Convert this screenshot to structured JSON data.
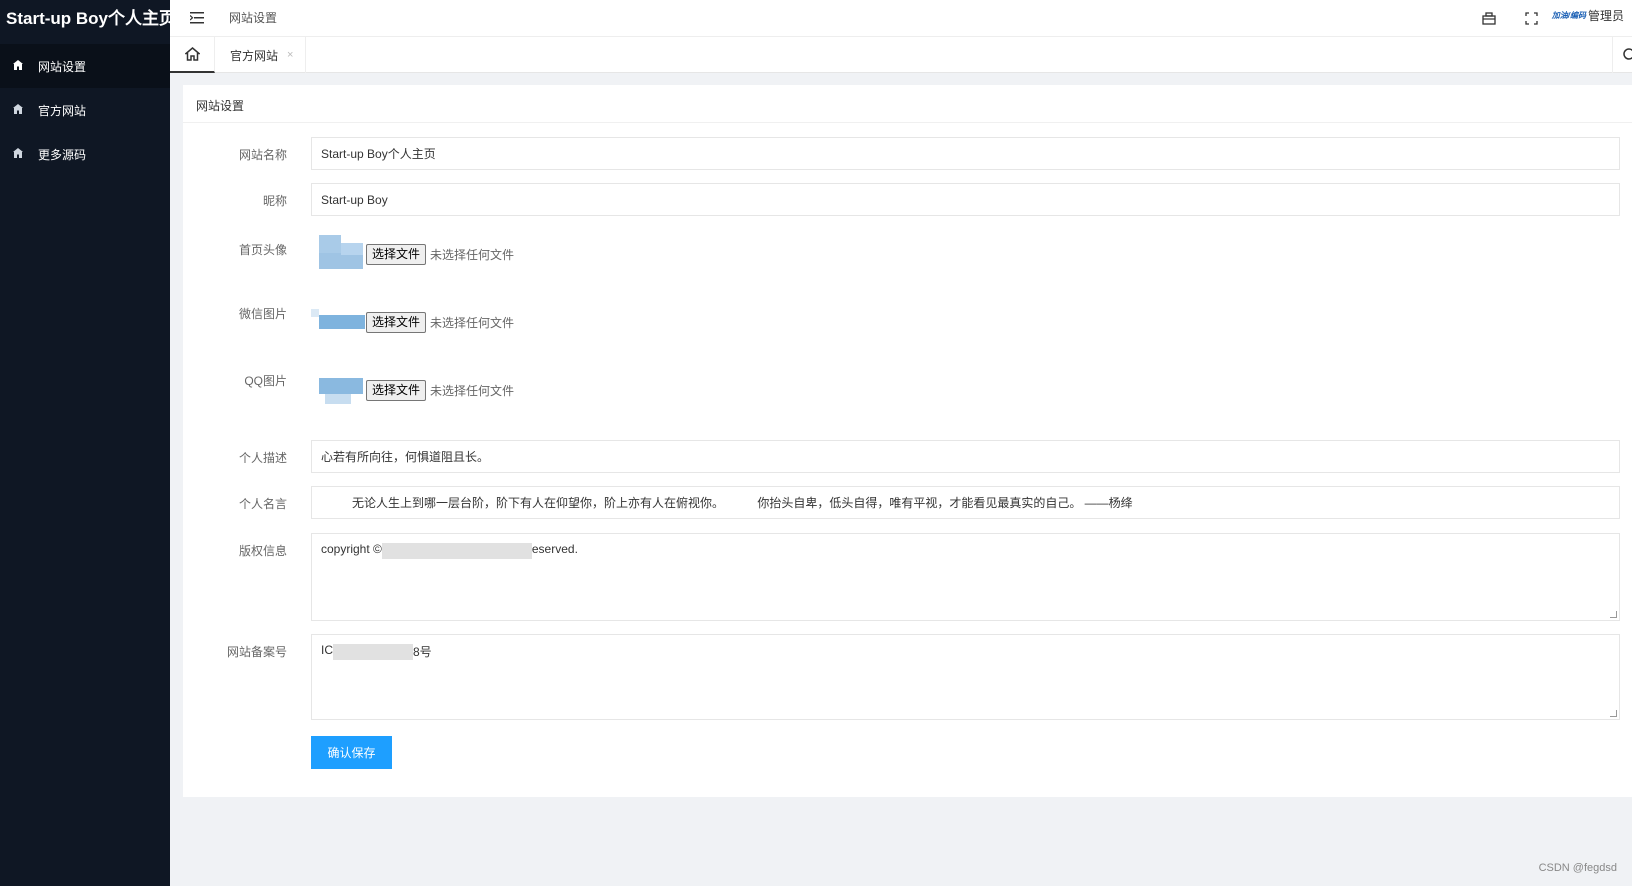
{
  "sidebar": {
    "logo": "Start-up Boy个人主页",
    "items": [
      {
        "label": "网站设置",
        "icon": "home-icon",
        "active": true
      },
      {
        "label": "官方网站",
        "icon": "home-icon",
        "active": false
      },
      {
        "label": "更多源码",
        "icon": "home-icon",
        "active": false
      }
    ]
  },
  "header": {
    "title": "网站设置",
    "admin_label": "管理员",
    "admin_badge": "加油/编码"
  },
  "tabs": {
    "items": [
      {
        "label": "官方网站",
        "close": "×"
      }
    ]
  },
  "card": {
    "title": "网站设置"
  },
  "form": {
    "site_name_label": "网站名称",
    "site_name_value": "Start-up Boy个人主页",
    "nickname_label": "昵称",
    "nickname_value": "Start-up Boy",
    "avatar_label": "首页头像",
    "wechat_label": "微信图片",
    "qq_label": "QQ图片",
    "file_button": "选择文件",
    "file_status": "未选择任何文件",
    "description_label": "个人描述",
    "description_value": "心若有所向往，何惧道阻且长。",
    "motto_label": "个人名言",
    "motto_value": "无论人生上到哪一层台阶，阶下有人在仰望你，阶上亦有人在俯视你。          你抬头自卑，低头自得，唯有平视，才能看见最真实的自己。 ——杨绛",
    "copyright_label": "版权信息",
    "copyright_prefix": "copyright ©",
    "copyright_suffix": "eserved.",
    "icp_label": "网站备案号",
    "icp_prefix": "IC",
    "icp_suffix": "8号",
    "save_button": "确认保存"
  },
  "watermark": "CSDN @fegdsd",
  "colors": {
    "sidebar_bg": "#0f1724",
    "primary": "#1e9fff"
  }
}
